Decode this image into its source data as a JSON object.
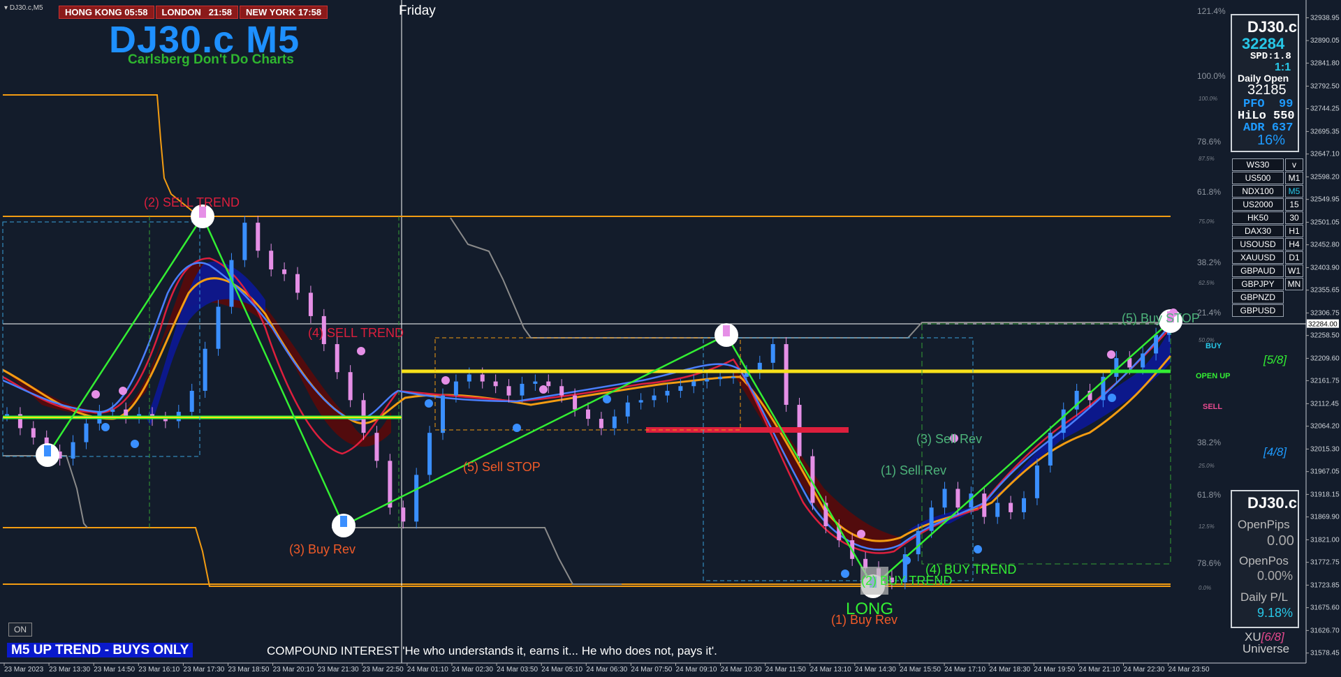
{
  "window": {
    "symbol_label": "DJ30.c,M5",
    "day_label": "Friday"
  },
  "clocks": [
    {
      "city": "HONG KONG",
      "time": "05:58"
    },
    {
      "city": "LONDON",
      "time": "21:58"
    },
    {
      "city": "NEW YORK",
      "time": "17:58"
    }
  ],
  "header": {
    "title": "DJ30.c M5",
    "subtitle": "Carlsberg Don't Do Charts"
  },
  "info_panel": {
    "symbol": "DJ30.c",
    "price": "32284",
    "spread": "SPD:1.8",
    "ratio": "1:1",
    "daily_open_label": "Daily Open",
    "daily_open": "32185",
    "pfo_label": "PFO",
    "pfo": "99",
    "hilo_label": "HiLo",
    "hilo": "550",
    "adr_label": "ADR",
    "adr": "637",
    "pct": "16%"
  },
  "symbols": [
    "WS30",
    "US500",
    "NDX100",
    "US2000",
    "HK50",
    "DAX30",
    "USOUSD",
    "XAUUSD",
    "GBPAUD",
    "GBPJPY",
    "GBPNZD",
    "GBPUSD"
  ],
  "timeframes": [
    {
      "label": "v",
      "active": false
    },
    {
      "label": "M1",
      "active": false
    },
    {
      "label": "M5",
      "active": true
    },
    {
      "label": "15",
      "active": false
    },
    {
      "label": "30",
      "active": false
    },
    {
      "label": "H1",
      "active": false
    },
    {
      "label": "H4",
      "active": false
    },
    {
      "label": "D1",
      "active": false
    },
    {
      "label": "W1",
      "active": false
    },
    {
      "label": "MN",
      "active": false
    }
  ],
  "position_panel": {
    "symbol": "DJ30.c",
    "open_pips_label": "OpenPips",
    "open_pips": "0.00",
    "open_pos_label": "OpenPos",
    "open_pos": "0.00%",
    "daily_pl_label": "Daily P/L",
    "daily_pl": "9.18%"
  },
  "bottom": {
    "on_button": "ON",
    "trend_banner": "M5 UP TREND - BUYS ONLY",
    "quote": "COMPOUND INTEREST  'He who understands it, earns it... He who does not, pays it'.",
    "xu_label": "XU",
    "xu_value": "[6/8]",
    "universe": "Universe"
  },
  "signals": {
    "buy": "BUY",
    "open_up": "OPEN UP",
    "sell": "SELL"
  },
  "murray": {
    "m58": "[5/8]",
    "m48": "[4/8]"
  },
  "colors": {
    "background": "#131c2b",
    "orange": "#f39c12",
    "green": "#33ee33",
    "yellow": "#f7e01a",
    "red": "#dd1f3d",
    "blue_line": "#4a7fff",
    "navy_fill": "#0c1890",
    "maroon_fill": "#5a0a0a",
    "grey_line": "#8a8a8a",
    "pink_candle": "#e58fe6",
    "blue_candle": "#3a8fff"
  },
  "chart_data": {
    "type": "candlestick",
    "symbol": "DJ30.c",
    "timeframe": "M5",
    "y_ticks": [
      32938.95,
      32890.05,
      32841.8,
      32792.5,
      32744.25,
      32695.35,
      32647.1,
      32598.2,
      32549.95,
      32501.05,
      32452.8,
      32403.9,
      32355.65,
      32306.75,
      32258.5,
      32209.6,
      32161.75,
      32112.45,
      32064.2,
      32015.3,
      31967.05,
      31918.15,
      31869.9,
      31821.0,
      31772.75,
      31723.85,
      31675.6,
      31626.7,
      31578.45
    ],
    "ylim": [
      31560,
      32965
    ],
    "current_price": "32284.00",
    "x_ticks": [
      "23 Mar 2023",
      "23 Mar 13:30",
      "23 Mar 14:50",
      "23 Mar 16:10",
      "23 Mar 17:30",
      "23 Mar 18:50",
      "23 Mar 20:10",
      "23 Mar 21:30",
      "23 Mar 22:50",
      "24 Mar 01:10",
      "24 Mar 02:30",
      "24 Mar 03:50",
      "24 Mar 05:10",
      "24 Mar 06:30",
      "24 Mar 07:50",
      "24 Mar 09:10",
      "24 Mar 10:30",
      "24 Mar 11:50",
      "24 Mar 13:10",
      "24 Mar 14:30",
      "24 Mar 15:50",
      "24 Mar 17:10",
      "24 Mar 18:30",
      "24 Mar 19:50",
      "24 Mar 21:10",
      "24 Mar 22:30",
      "24 Mar 23:50"
    ],
    "close": [
      32090,
      32060,
      32040,
      32010,
      31995,
      32030,
      32070,
      32095,
      32100,
      32085,
      32090,
      32080,
      32075,
      32095,
      32140,
      32230,
      32320,
      32420,
      32500,
      32440,
      32400,
      32390,
      32350,
      32300,
      32240,
      32180,
      32120,
      32050,
      31990,
      31890,
      31860,
      31960,
      32050,
      32130,
      32160,
      32175,
      32160,
      32150,
      32130,
      32155,
      32160,
      32150,
      32130,
      32100,
      32080,
      32060,
      32085,
      32115,
      32120,
      32130,
      32140,
      32150,
      32160,
      32165,
      32170,
      32170,
      32180,
      32200,
      32240,
      32110,
      32000,
      31900,
      31850,
      31820,
      31780,
      31760,
      31740,
      31730,
      31790,
      31840,
      31890,
      31930,
      31890,
      31920,
      31870,
      31900,
      31880,
      31910,
      31980,
      32050,
      32100,
      32140,
      32120,
      32170,
      32210,
      32190,
      32220,
      32260,
      32284
    ],
    "fib_labels": [
      "121.4%",
      "100.0%",
      "78.6%",
      "61.8%",
      "38.2%",
      "21.4%",
      "38.2%",
      "61.8%",
      "78.6%"
    ],
    "small_fib_labels": [
      "100.0%",
      "87.5%",
      "75.0%",
      "62.5%",
      "50.0%",
      "25.0%",
      "12.5%",
      "0.0%"
    ],
    "annotations": [
      {
        "text": "(2) SELL TREND",
        "color": "#dd1f3d"
      },
      {
        "text": "(4) SELL TREND",
        "color": "#dd1f3d"
      },
      {
        "text": "(3) Buy Rev",
        "color": "#f05a28"
      },
      {
        "text": "(5) Sell STOP",
        "color": "#f05a28"
      },
      {
        "text": "(3) Sell Rev",
        "color": "#4db37a"
      },
      {
        "text": "(1) Sell Rev",
        "color": "#4db37a"
      },
      {
        "text": "(4) BUY TREND",
        "color": "#33ee33"
      },
      {
        "text": "(2) BUY TREND",
        "color": "#33ee33"
      },
      {
        "text": "LONG",
        "color": "#33ee33"
      },
      {
        "text": "(1) Buy Rev",
        "color": "#f05a28"
      },
      {
        "text": "(5) Buy STOP",
        "color": "#4db37a"
      }
    ]
  }
}
